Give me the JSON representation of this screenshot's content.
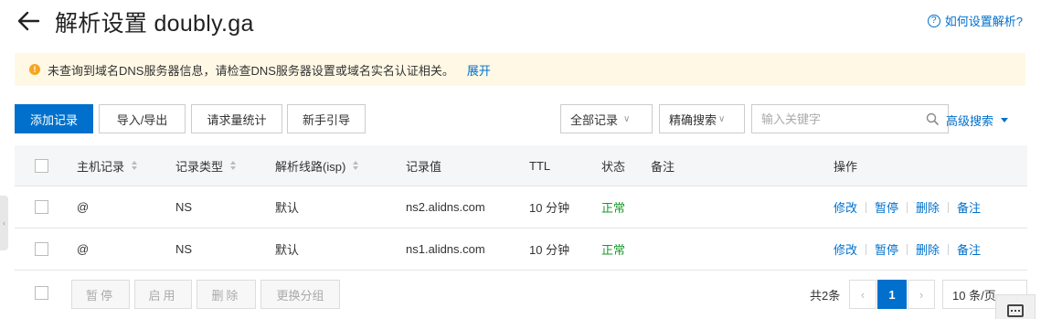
{
  "header": {
    "title": "解析设置 doubly.ga",
    "help_label": "如何设置解析?"
  },
  "notice": {
    "message": "未查询到域名DNS服务器信息，请检查DNS服务器设置或域名实名认证相关。",
    "expand_label": "展开"
  },
  "toolbar": {
    "add_label": "添加记录",
    "import_export_label": "导入/导出",
    "stats_label": "请求量统计",
    "guide_label": "新手引导",
    "record_filter": "全部记录",
    "search_mode": "精确搜索",
    "search_placeholder": "输入关键字",
    "advanced_search_label": "高级搜索"
  },
  "table": {
    "columns": [
      "主机记录",
      "记录类型",
      "解析线路(isp)",
      "记录值",
      "TTL",
      "状态",
      "备注",
      "操作"
    ],
    "rows": [
      {
        "host": "@",
        "type": "NS",
        "line": "默认",
        "value": "ns2.alidns.com",
        "ttl": "10 分钟",
        "status": "正常",
        "note": ""
      },
      {
        "host": "@",
        "type": "NS",
        "line": "默认",
        "value": "ns1.alidns.com",
        "ttl": "10 分钟",
        "status": "正常",
        "note": ""
      }
    ],
    "actions": [
      "修改",
      "暂停",
      "删除",
      "备注"
    ]
  },
  "footer": {
    "pause_label": "暂停",
    "enable_label": "启用",
    "delete_label": "删除",
    "change_group_label": "更换分组",
    "total_label": "共2条",
    "current_page": "1",
    "page_size": "10 条/页"
  },
  "colors": {
    "accent": "#0070cc",
    "status_ok": "#1a9a2a",
    "notice_bg": "#fff8e5",
    "warning": "#f4a623"
  }
}
